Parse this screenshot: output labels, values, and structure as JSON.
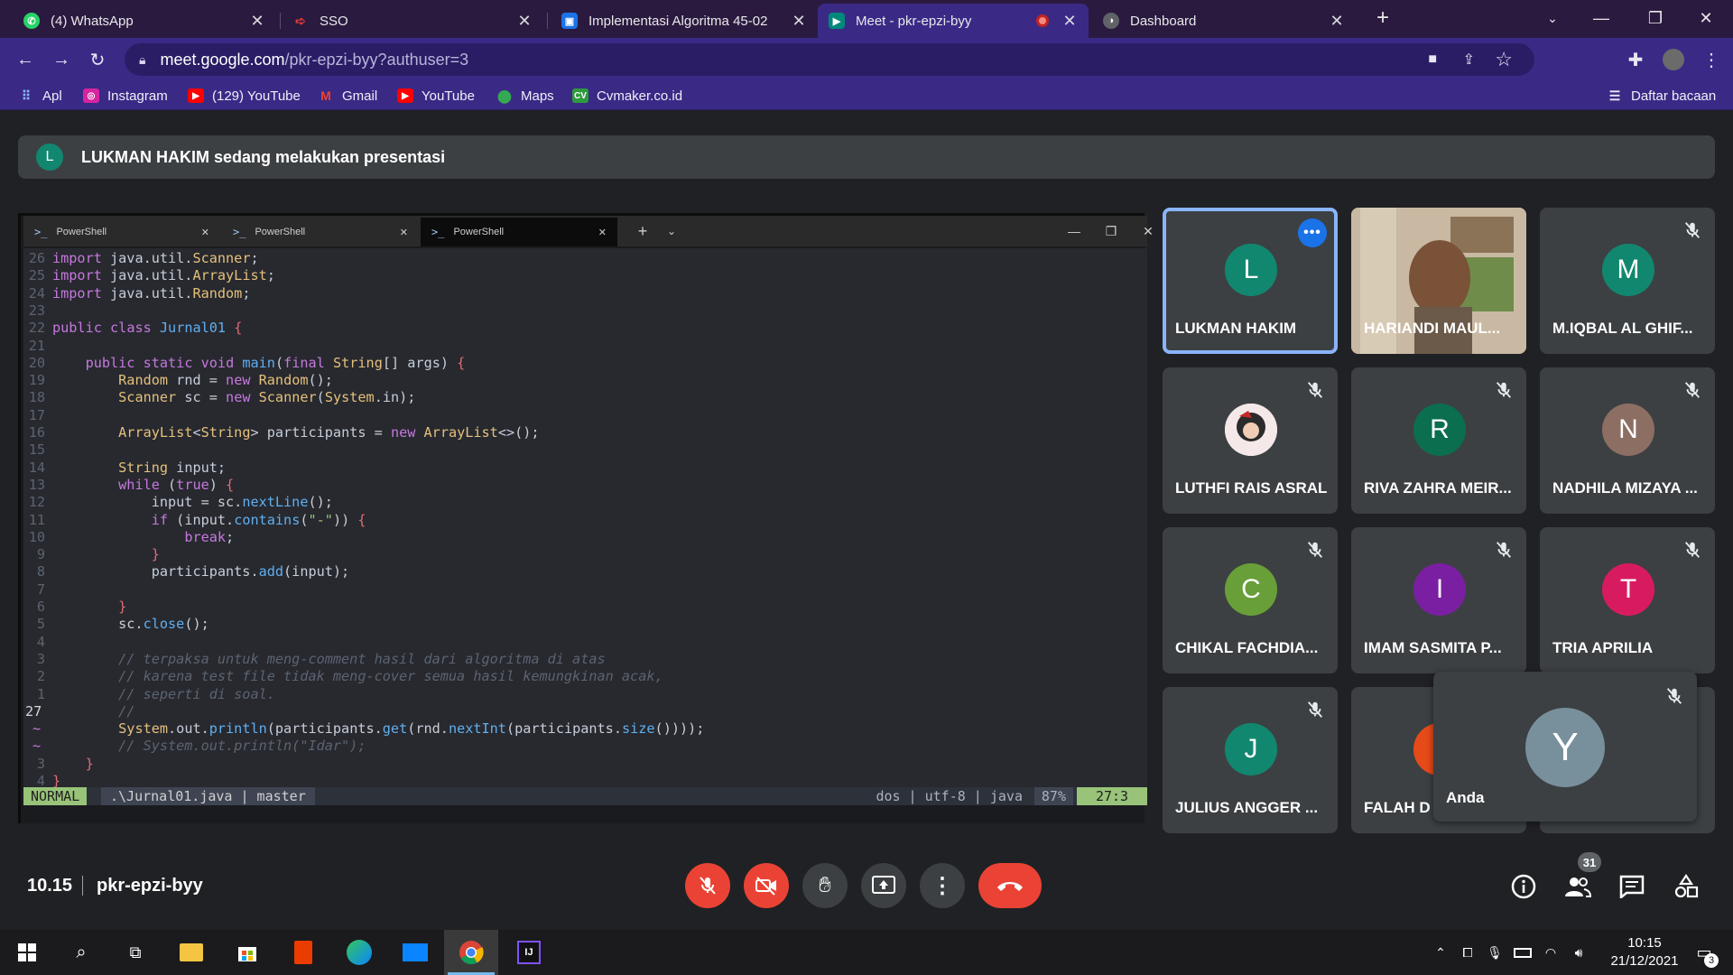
{
  "browser": {
    "tabs": [
      {
        "title": "(4) WhatsApp",
        "icon": "whatsapp-icon",
        "color": "#25d366"
      },
      {
        "title": "SSO",
        "icon": "sso-icon",
        "color": "#e53935"
      },
      {
        "title": "Implementasi Algoritma 45-02",
        "icon": "classroom-icon",
        "color": "#1a73e8"
      },
      {
        "title": "Meet - pkr-epzi-byy",
        "icon": "meet-icon",
        "color": "#00897b",
        "active": true
      },
      {
        "title": "Dashboard",
        "icon": "dashboard-icon",
        "color": "#5f6368"
      }
    ],
    "url_host": "meet.google.com",
    "url_path": "/pkr-epzi-byy?authuser=3",
    "bookmarks": [
      {
        "label": "Apl",
        "icon": "apps-grid-icon"
      },
      {
        "label": "Instagram",
        "icon": "instagram-icon"
      },
      {
        "label": "(129) YouTube",
        "icon": "youtube-icon"
      },
      {
        "label": "Gmail",
        "icon": "gmail-icon"
      },
      {
        "label": "YouTube",
        "icon": "youtube-icon"
      },
      {
        "label": "Maps",
        "icon": "maps-icon"
      },
      {
        "label": "Cvmaker.co.id",
        "icon": "cvmaker-icon"
      }
    ],
    "reading_list": "Daftar bacaan"
  },
  "meet": {
    "presenter_initial": "L",
    "presenter_banner": "LUKMAN HAKIM sedang melakukan presentasi",
    "meeting_time": "10.15",
    "meeting_code": "pkr-epzi-byy",
    "participant_count": "31",
    "self_name": "Anda",
    "self_initial": "Y",
    "participants": [
      {
        "name": "LUKMAN HAKIM",
        "initial": "L",
        "color": "#12876f",
        "speaking": true
      },
      {
        "name": "HARIANDI MAUL...",
        "initial": "",
        "color": "",
        "video": true
      },
      {
        "name": "M.IQBAL AL GHIF...",
        "initial": "M",
        "color": "#12876f"
      },
      {
        "name": "LUTHFI RAIS ASRAL",
        "initial": "",
        "color": "#3c4043",
        "photo": true
      },
      {
        "name": "RIVA ZAHRA MEIR...",
        "initial": "R",
        "color": "#0b6e4f"
      },
      {
        "name": "NADHILA MIZAYA ...",
        "initial": "N",
        "color": "#8d6e63"
      },
      {
        "name": "CHIKAL FACHDIA...",
        "initial": "C",
        "color": "#689f38"
      },
      {
        "name": "IMAM SASMITA P...",
        "initial": "I",
        "color": "#7b1fa2"
      },
      {
        "name": "TRIA APRILIA",
        "initial": "T",
        "color": "#d81b60"
      },
      {
        "name": "JULIUS ANGGER ...",
        "initial": "J",
        "color": "#12876f"
      },
      {
        "name": "FALAH D",
        "initial": "",
        "color": "#e64a19"
      }
    ]
  },
  "terminal": {
    "tabs": [
      "PowerShell",
      "PowerShell",
      "PowerShell"
    ],
    "status_mode": "NORMAL",
    "status_file": ".\\Jurnal01.java | master",
    "status_info": "dos | utf-8 | java",
    "status_pct": "87%",
    "status_pos": "27:3",
    "lines": [
      {
        "n": "26",
        "t": "import java.util.Scanner;"
      },
      {
        "n": "25",
        "t": "import java.util.ArrayList;"
      },
      {
        "n": "24",
        "t": "import java.util.Random;"
      },
      {
        "n": "23",
        "t": ""
      },
      {
        "n": "22",
        "t": "public class Jurnal01 {"
      },
      {
        "n": "21",
        "t": ""
      },
      {
        "n": "20",
        "t": "    public static void main(final String[] args) {"
      },
      {
        "n": "19",
        "t": "        Random rnd = new Random();"
      },
      {
        "n": "18",
        "t": "        Scanner sc = new Scanner(System.in);"
      },
      {
        "n": "17",
        "t": ""
      },
      {
        "n": "16",
        "t": "        ArrayList<String> participants = new ArrayList<>();"
      },
      {
        "n": "15",
        "t": ""
      },
      {
        "n": "14",
        "t": "        String input;"
      },
      {
        "n": "13",
        "t": "        while (true) {"
      },
      {
        "n": "12",
        "t": "            input = sc.nextLine();"
      },
      {
        "n": "11",
        "t": "            if (input.contains(\"-\")) {"
      },
      {
        "n": "10",
        "t": "                break;"
      },
      {
        "n": "9",
        "t": "            }"
      },
      {
        "n": "8",
        "t": "            participants.add(input);"
      },
      {
        "n": "7",
        "t": ""
      },
      {
        "n": "6",
        "t": "        }"
      },
      {
        "n": "5",
        "t": "        sc.close();"
      },
      {
        "n": "4",
        "t": ""
      },
      {
        "n": "3",
        "t": "        // terpaksa untuk meng-comment hasil dari algoritma di atas"
      },
      {
        "n": "2",
        "t": "        // karena test file tidak meng-cover semua hasil kemungkinan acak,"
      },
      {
        "n": "1",
        "t": "        // seperti di soal."
      },
      {
        "n": "27",
        "t": "        //"
      },
      {
        "n": "~",
        "t": "        System.out.println(participants.get(rnd.nextInt(participants.size())));"
      },
      {
        "n": "~",
        "t": "        // System.out.println(\"Idar\");"
      },
      {
        "n": "3",
        "t": "    }"
      },
      {
        "n": "4",
        "t": "}"
      }
    ]
  },
  "taskbar": {
    "time": "10:15",
    "date": "21/12/2021",
    "notification_count": "3"
  }
}
